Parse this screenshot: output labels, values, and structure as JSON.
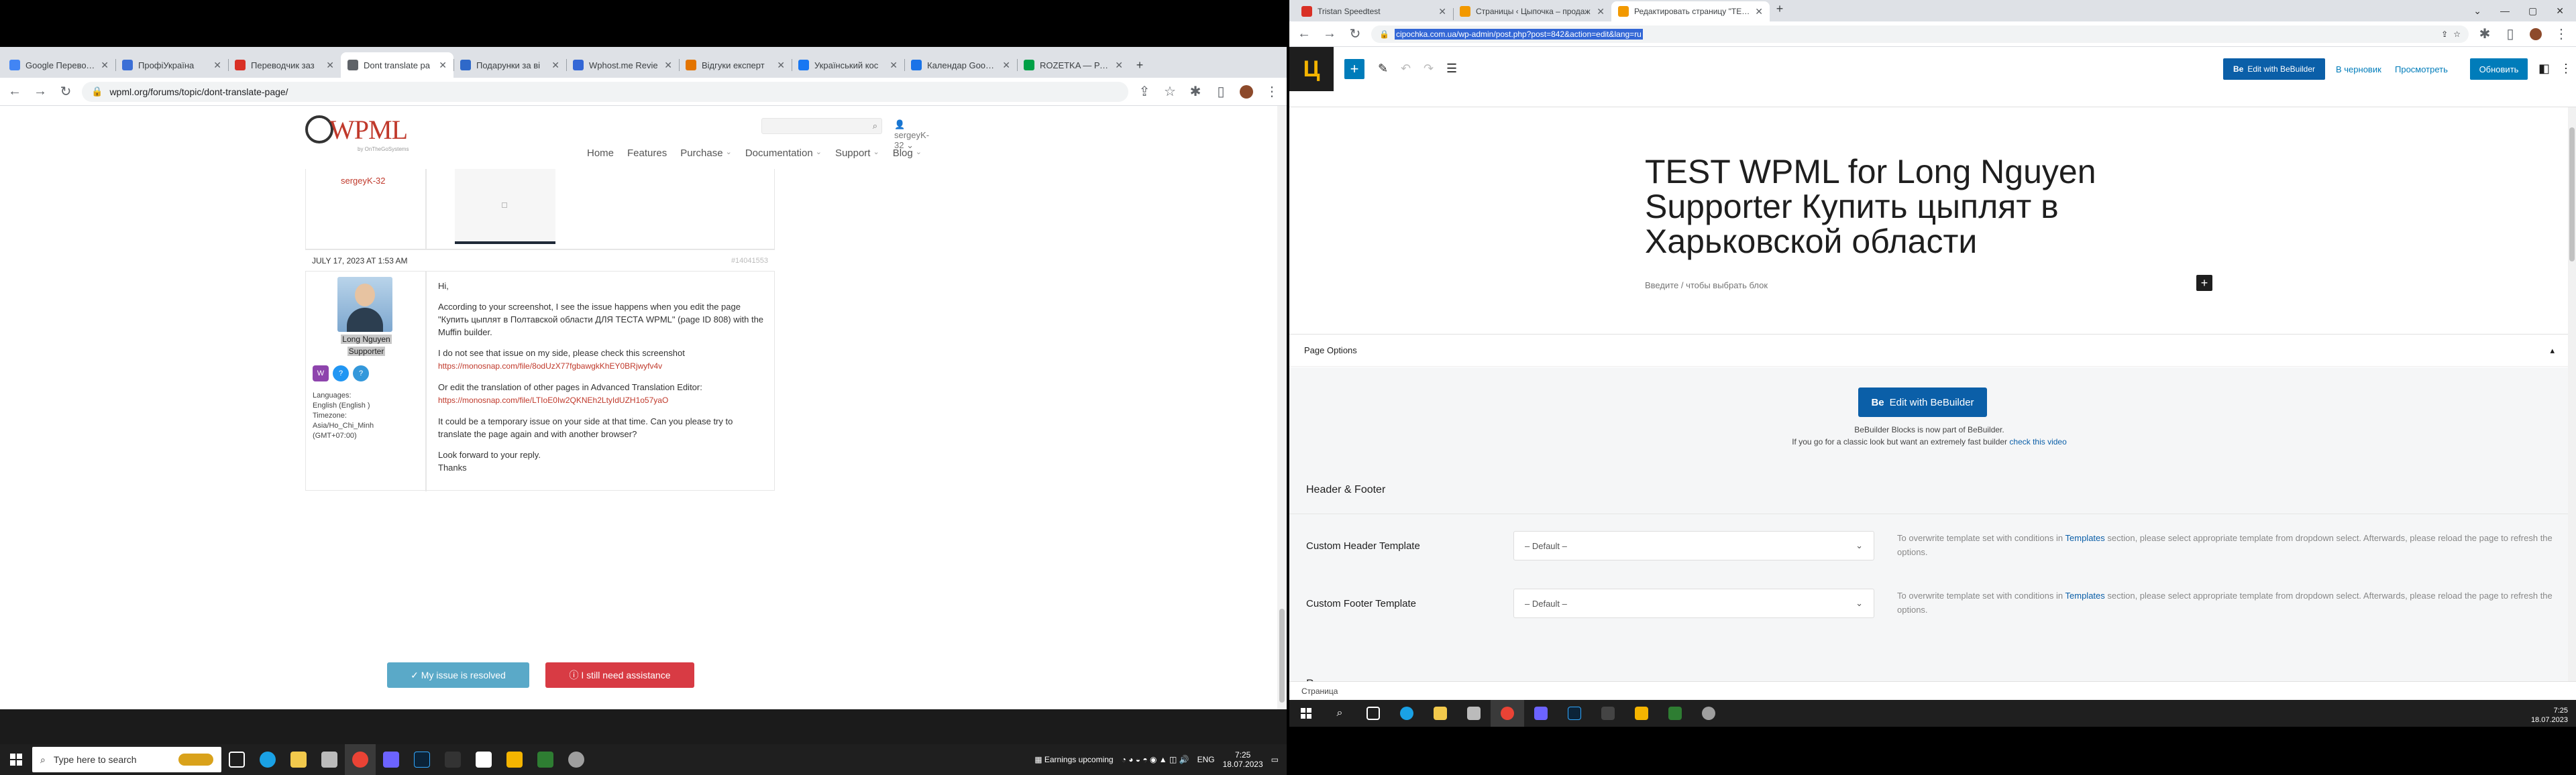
{
  "left_browser": {
    "tabs": [
      {
        "title": "Google Переводч",
        "color": "#4285f4"
      },
      {
        "title": "ПрофіУкраїна",
        "color": "#3b6fd6"
      },
      {
        "title": "Переводчик заз",
        "color": "#d93025"
      },
      {
        "title": "Dont translate pa",
        "color": "#5f6368",
        "active": true
      },
      {
        "title": "Подарунки за ві",
        "color": "#2f69c9"
      },
      {
        "title": "Wphost.me Revie",
        "color": "#3367d6"
      },
      {
        "title": "Відгуки експерт",
        "color": "#e37400"
      },
      {
        "title": "Український кос",
        "color": "#1877f2"
      },
      {
        "title": "Календар Google",
        "color": "#1a73e8"
      },
      {
        "title": "ROZETKA — Резул",
        "color": "#00a046"
      }
    ],
    "url": "wpml.org/forums/topic/dont-translate-page/"
  },
  "wpml_site": {
    "logo_text": "WPML",
    "logo_sub": "by OnTheGoSystems",
    "user": "sergeyK-32",
    "nav": [
      "Home",
      "Features",
      "Purchase",
      "Documentation",
      "Support",
      "Blog"
    ],
    "prev_author": "sergeyK-32",
    "post_date": "JULY 17, 2023 AT 1:53 AM",
    "post_id": "#14041553",
    "author_name": "Long Nguyen",
    "author_role": "Supporter",
    "languages_label": "Languages:",
    "languages": "English (English )",
    "timezone_label": "Timezone:",
    "timezone": "Asia/Ho_Chi_Minh",
    "timezone_offset": "(GMT+07:00)",
    "reply": {
      "greeting": "Hi,",
      "p1": "According to your screenshot, I see the issue happens when you edit the page \"Купить цыплят в Полтавской области ДЛЯ ТЕСТА WPML\" (page ID 808) with the Muffin builder.",
      "p2": "I do not see that issue on my side, please check this screenshot",
      "link1": "https://monosnap.com/file/8odUzX77fgbawgkKhEY0BRjwyfv4v",
      "p3": "Or edit the translation of other pages in Advanced Translation Editor:",
      "link2": "https://monosnap.com/file/LTIoE0Iw2QKNEh2LtyIdUZH1o57yaO",
      "p4": "It could be a temporary issue on your side at that time. Can you please try to translate the page again and with another browser?",
      "p5": "Look forward to your reply.",
      "p6": "Thanks"
    },
    "resolved_btn": "✓ My issue is resolved",
    "assist_btn": "I still need assistance"
  },
  "left_taskbar": {
    "search_placeholder": "Type here to search",
    "weather": "Earnings upcoming",
    "lang": "ENG",
    "time": "7:25",
    "date": "18.07.2023"
  },
  "right_browser": {
    "tabs": [
      {
        "title": "Tristan Speedtest",
        "color": "#d93025"
      },
      {
        "title": "Страницы ‹ Цыпочка – продаж",
        "color": "#f29900"
      },
      {
        "title": "Редактировать страницу \"TEST",
        "color": "#f29900",
        "active": true
      }
    ],
    "url": "cipochka.com.ua/wp-admin/post.php?post=842&action=edit&lang=ru"
  },
  "wp_editor": {
    "edit_with_be": "Edit with BeBuilder",
    "draft": "В черновик",
    "preview": "Просмотреть",
    "update": "Обновить",
    "title": "TEST WPML for Long Nguyen Supporter Купить цыплят в Харьковской области",
    "block_hint": "Введите / чтобы выбрать блок",
    "page_options": "Page Options",
    "be_big": "Edit with BeBuilder",
    "be_note1": "BeBuilder Blocks is now part of BeBuilder.",
    "be_note2_pre": "If you go for a classic look but want an extremely fast builder",
    "be_note2_link": "check this video",
    "hf_title": "Header & Footer",
    "header_label": "Custom Header Template",
    "footer_label": "Custom Footer Template",
    "select_default": "– Default –",
    "help_pre": "To overwrite template set with conditions in",
    "help_link": "Templates",
    "help_post": "section, please select appropriate template from dropdown select. Afterwards, please reload the page to refresh the options.",
    "popup_title": "Popup",
    "status": "Страница"
  },
  "right_taskbar": {
    "time": "7:25",
    "date": "18.07.2023"
  }
}
